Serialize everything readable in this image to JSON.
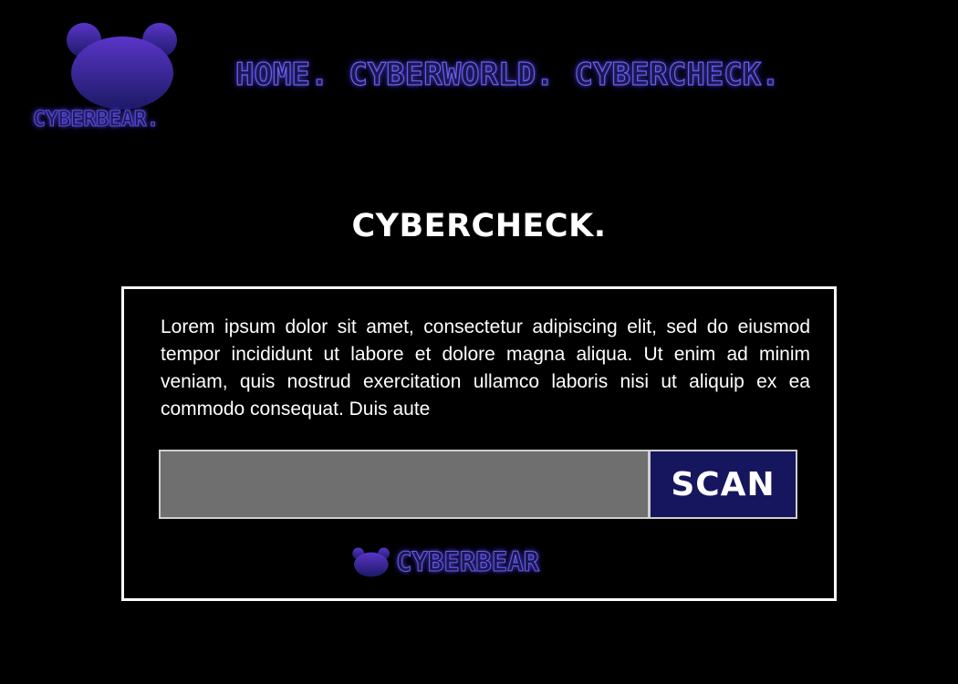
{
  "brand": {
    "logo_text": "CYBERBEAR.",
    "footer_text": "CYBERBEAR",
    "logo_icon": "bear-head-icon"
  },
  "nav": {
    "items": [
      {
        "label": "HOME."
      },
      {
        "label": "CYBERWORLD."
      },
      {
        "label": "CYBERCHECK."
      }
    ]
  },
  "main": {
    "title": "CYBERCHECK.",
    "description": "Lorem ipsum dolor sit amet, consectetur adipiscing elit, sed do eiusmod tempor incididunt ut labore et dolore magna aliqua. Ut enim ad minim veniam, quis nostrud exercitation ullamco laboris nisi ut aliquip ex ea commodo consequat. Duis aute",
    "scan": {
      "input_value": "",
      "input_placeholder": "",
      "button_label": "SCAN"
    }
  },
  "colors": {
    "background": "#000000",
    "accent": "#16165e",
    "bear_top": "#5a35c8",
    "bear_bottom": "#1c1a66",
    "input_bg": "#6f6f6f",
    "text": "#ffffff"
  }
}
